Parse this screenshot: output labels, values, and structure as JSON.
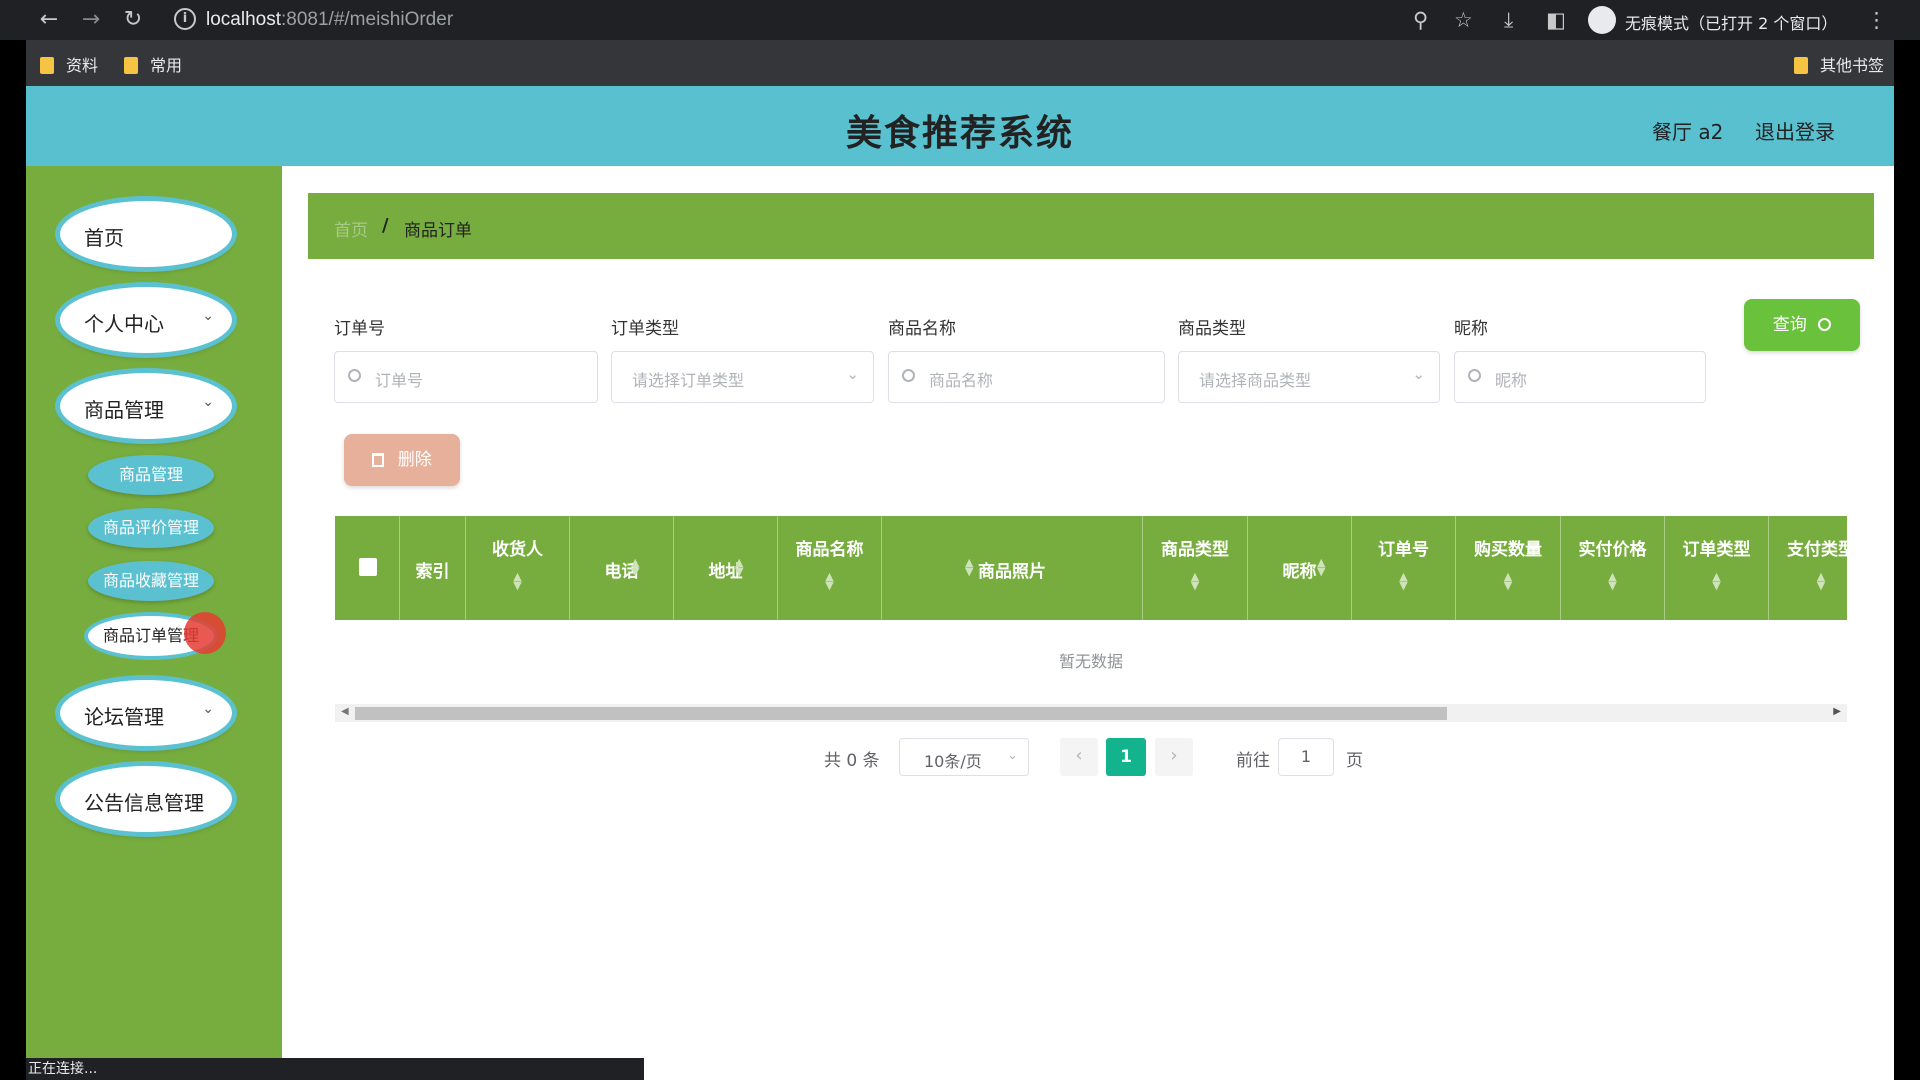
{
  "browser": {
    "url_host": "localhost",
    "url_rest": ":8081/#/meishiOrder",
    "incognito_text": "无痕模式（已打开 2 个窗口）",
    "bookmarks": [
      "资料",
      "常用"
    ],
    "other_bookmarks": "其他书签",
    "status_text": "正在连接..."
  },
  "header": {
    "title": "美食推荐系统",
    "user": "餐厅 a2",
    "logout": "退出登录"
  },
  "sidebar": {
    "items": [
      {
        "label": "首页"
      },
      {
        "label": "个人中心"
      },
      {
        "label": "商品管理"
      },
      {
        "label": "论坛管理"
      },
      {
        "label": "公告信息管理"
      }
    ],
    "sub_items": [
      "商品管理",
      "商品评价管理",
      "商品收藏管理",
      "商品订单管理"
    ]
  },
  "breadcrumb": {
    "home": "首页",
    "sep": "/",
    "current": "商品订单"
  },
  "filters": {
    "order_no": {
      "label": "订单号",
      "placeholder": "订单号"
    },
    "order_type": {
      "label": "订单类型",
      "placeholder": "请选择订单类型"
    },
    "product_name": {
      "label": "商品名称",
      "placeholder": "商品名称"
    },
    "product_type": {
      "label": "商品类型",
      "placeholder": "请选择商品类型"
    },
    "nickname": {
      "label": "昵称",
      "placeholder": "昵称"
    }
  },
  "buttons": {
    "query": "查询",
    "delete": "删除"
  },
  "table": {
    "columns": [
      "索引",
      "收货人",
      "电话",
      "地址",
      "商品名称",
      "商品照片",
      "商品类型",
      "昵称",
      "订单号",
      "购买数量",
      "实付价格",
      "订单类型",
      "支付类型"
    ],
    "empty_text": "暂无数据"
  },
  "pagination": {
    "total": "共 0 条",
    "page_size": "10条/页",
    "current_page": "1",
    "goto": "前往",
    "jump_value": "1",
    "page_unit": "页"
  },
  "colors": {
    "header": "#58c0cf",
    "sidebar": "#77ad3e",
    "accent": "#13b48d"
  }
}
